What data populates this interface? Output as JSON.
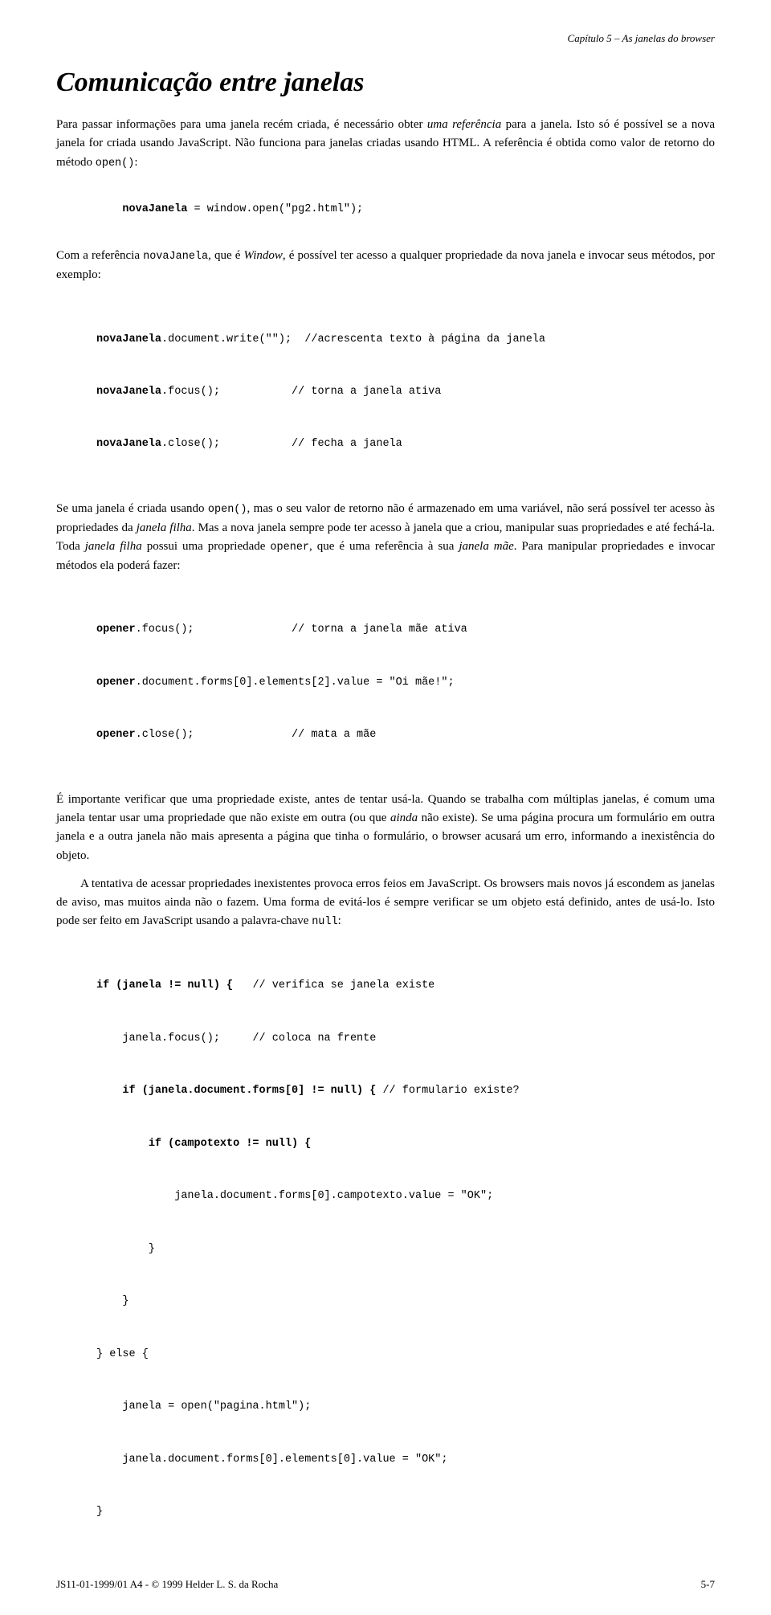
{
  "header": {
    "text": "Capítulo 5 – As janelas do browser"
  },
  "chapter_title": "Comunicação entre janelas",
  "paragraphs": {
    "p1": "Para passar informações para uma janela recém criada, é necessário obter uma referência para a janela. Isto só é possível se a nova janela for criada usando JavaScript. Não funciona para janelas criadas usando HTML. A referência é obtida como valor de retorno do método open():",
    "code1_label": "novaJanela = window.open(\"pg2.html\");",
    "p2_part1": "Com a referência ",
    "p2_novaJanela": "novaJanela",
    "p2_part2": ", que é ",
    "p2_Window": "Window",
    "p2_part3": ", é possível ter acesso a qualquer propriedade da nova janela e invocar seus métodos, por exemplo:",
    "code2_line1_code": "novaJanela.document.write(\"\");",
    "code2_line1_comment": " //acrescenta texto à página da janela",
    "code2_line2_code": "novaJanela.focus();",
    "code2_line2_comment": "          // torna a janela ativa",
    "code2_line3_code": "novaJanela.close();",
    "code2_line3_comment": "          // fecha a janela",
    "p3": "Se uma janela é criada usando open(), mas o seu valor de retorno não é armazenado em uma variável, não será possível ter acesso às propriedades da janela filha. Mas a nova janela sempre pode ter acesso à janela que a criou, manipular suas propriedades e até fechá-la. Toda janela filha possui uma propriedade opener, que é uma referência à sua janela mãe. Para manipular propriedades e invocar métodos ela poderá fazer:",
    "code3_line1_code": "opener.focus();",
    "code3_line1_comment": "              // torna a janela mãe ativa",
    "code3_line2_code": "opener.document.forms[0].elements[2].value = \"Oi mãe!\";",
    "code3_line3_code": "opener.close();",
    "code3_line3_comment": "              // mata a mãe",
    "p4": "É importante verificar que uma propriedade existe, antes de tentar usá-la. Quando se trabalha com múltiplas janelas, é comum uma janela tentar usar uma propriedade que não existe em outra (ou que ainda não existe). Se uma página procura um formulário em outra janela e a outra janela não mais apresenta a página que tinha o formulário, o browser acusará um erro, informando a inexistência do objeto.",
    "p5": "A tentativa de acessar propriedades inexistentes provoca erros feios em JavaScript. Os browsers mais novos já escondem as janelas de aviso, mas muitos ainda não o fazem. Uma forma de evitá-los é sempre verificar se um objeto está definido, antes de usá-lo. Isto pode ser feito em JavaScript usando a palavra-chave null:",
    "code4_lines": [
      {
        "code": "if (janela != null) {",
        "comment": "   // verifica se janela existe"
      },
      {
        "code": "    janela.focus();",
        "comment": "    // coloca na frente"
      },
      {
        "code": "    if (janela.document.forms[0] != null) {",
        "comment": " // formulario existe?"
      },
      {
        "code": "        if (campotexto != null) {",
        "comment": ""
      },
      {
        "code": "            janela.document.forms[0].campotexto.value = \"OK\";",
        "comment": ""
      },
      {
        "code": "        }",
        "comment": ""
      },
      {
        "code": "    }",
        "comment": ""
      },
      {
        "code": "} else {",
        "comment": ""
      },
      {
        "code": "    janela = open(\"pagina.html\");",
        "comment": ""
      },
      {
        "code": "    janela.document.forms[0].elements[0].value = \"OK\";",
        "comment": ""
      },
      {
        "code": "}",
        "comment": ""
      }
    ]
  },
  "footer": {
    "left": "JS11-01-1999/01 A4 - © 1999 Helder L. S. da Rocha",
    "right": "5-7"
  }
}
